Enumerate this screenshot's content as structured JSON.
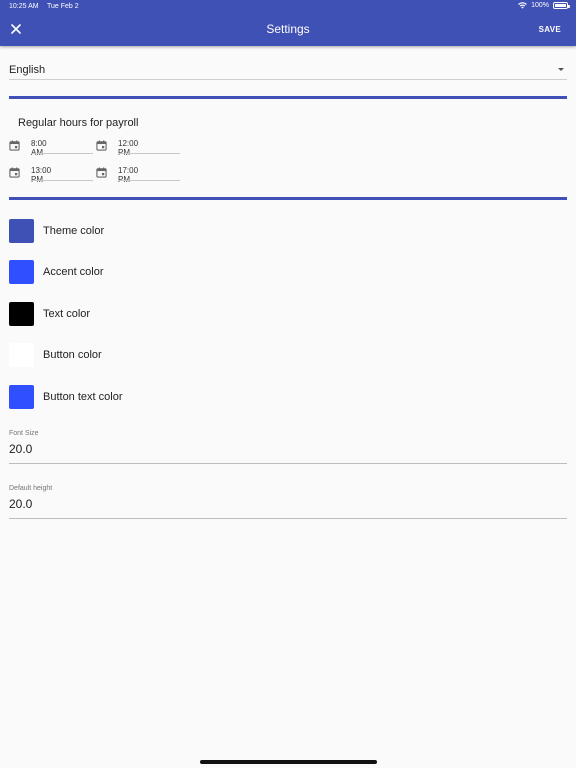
{
  "status_bar": {
    "time": "10:25 AM",
    "date": "Tue Feb 2",
    "battery": "100%"
  },
  "app_bar": {
    "title": "Settings",
    "save_label": "SAVE",
    "close_icon": "close-icon"
  },
  "language": {
    "selected": "English"
  },
  "payroll": {
    "heading": "Regular hours for payroll",
    "times": [
      "8:00 AM",
      "12:00 PM",
      "13:00 PM",
      "17:00 PM"
    ]
  },
  "colors": [
    {
      "label": "Theme color",
      "hex": "#3f51b5"
    },
    {
      "label": "Accent color",
      "hex": "#304ffe"
    },
    {
      "label": "Text color",
      "hex": "#000000"
    },
    {
      "label": "Button color",
      "hex": "#ffffff"
    },
    {
      "label": "Button text color",
      "hex": "#304ffe"
    }
  ],
  "font_size": {
    "label": "Font Size",
    "value": "20.0"
  },
  "default_height": {
    "label": "Default height",
    "value": "20.0"
  }
}
